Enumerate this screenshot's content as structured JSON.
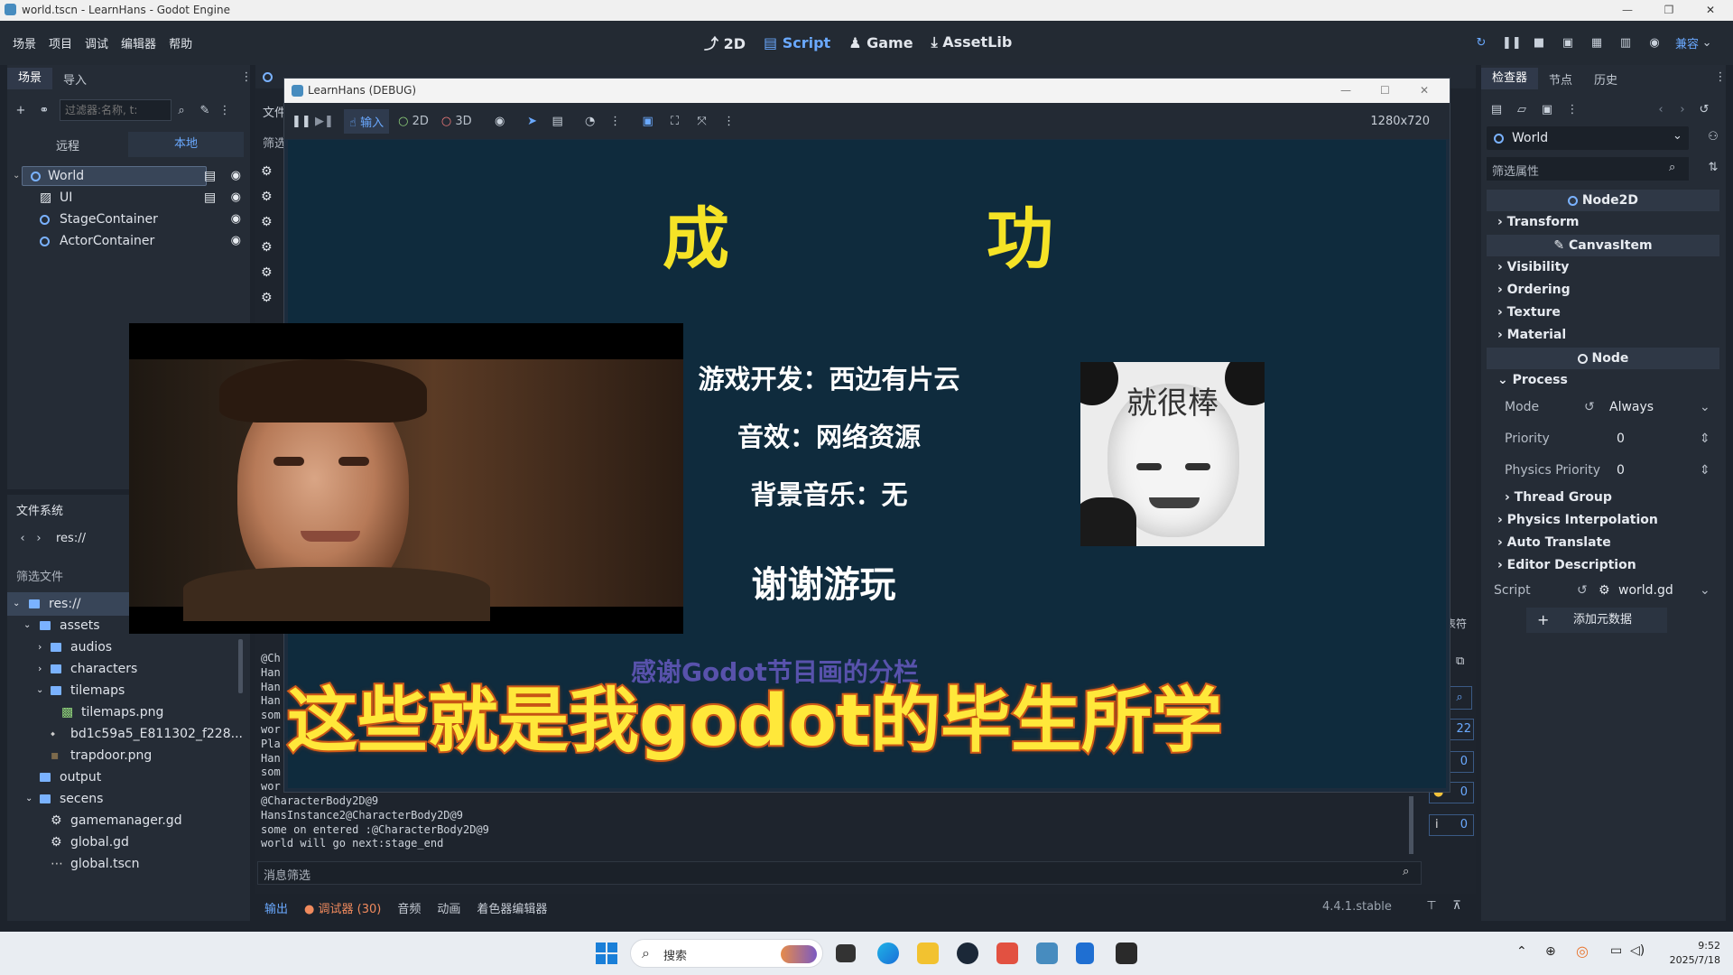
{
  "titlebar": {
    "title": "world.tscn - LearnHans - Godot Engine"
  },
  "menu": {
    "items": [
      "场景",
      "项目",
      "调试",
      "编辑器",
      "帮助"
    ]
  },
  "workspaces": {
    "w2d": "2D",
    "script": "Script",
    "game": "Game",
    "assetlib": "AssetLib"
  },
  "render_mode": "兼容",
  "scene_dock": {
    "tabs": [
      "场景",
      "导入"
    ],
    "filter_placeholder": "过滤器:名称, t:",
    "toggle": [
      "远程",
      "本地"
    ],
    "nodes": [
      "World",
      "UI",
      "StageContainer",
      "ActorContainer"
    ]
  },
  "filesystem": {
    "title": "文件系统",
    "path": "res://",
    "filter_placeholder": "筛选文件",
    "items": [
      "res://",
      "assets",
      "audios",
      "characters",
      "tilemaps",
      "tilemaps.png",
      "bd1c59a5_E811302_f228...",
      "trapdoor.png",
      "output",
      "secens",
      "gamemanager.gd",
      "global.gd",
      "global.tscn"
    ]
  },
  "game_window": {
    "title": "LearnHans (DEBUG)",
    "toolbar": {
      "input": "输入",
      "m2d": "2D",
      "m3d": "3D",
      "resolution": "1280x720"
    },
    "heading_left": "成",
    "heading_right": "功",
    "credits": [
      "游戏开发：西边有片云",
      "音效：网络资源",
      "背景音乐：无"
    ],
    "thanks": "谢谢游玩",
    "faded_text": "感谢Godot节目画的分栏",
    "meme_text": "就很棒",
    "overlay_caption": "这些就是我godot的毕生所学"
  },
  "console": {
    "partial_lines": [
      "@Ch",
      "Han",
      "Han",
      "Han",
      "som",
      "wor",
      "Pla",
      "Han",
      "som",
      "wor"
    ],
    "lines": [
      "@CharacterBody2D@9",
      "HansInstance2@CharacterBody2D@9",
      "some on entered :@CharacterBody2D@9",
      "world will go next:stage_end"
    ],
    "filter_placeholder": "消息筛选"
  },
  "bottom_tabs": {
    "output": "输出",
    "debugger": "调试器 (30)",
    "audio": "音频",
    "animation": "动画",
    "shader": "着色器编辑器"
  },
  "version": "4.4.1.stable",
  "right_counters": [
    "22",
    "0",
    "0",
    "0"
  ],
  "right_label": "表符",
  "inspector": {
    "tabs": [
      "检查器",
      "节点",
      "历史"
    ],
    "object": "World",
    "filter_placeholder": "筛选属性",
    "sections": {
      "node2d": "Node2D",
      "transform": "Transform",
      "canvasitem": "CanvasItem",
      "visibility": "Visibility",
      "ordering": "Ordering",
      "texture": "Texture",
      "material": "Material",
      "node": "Node",
      "process": "Process",
      "thread_group": "Thread Group",
      "physics_interp": "Physics Interpolation",
      "auto_translate": "Auto Translate",
      "editor_desc": "Editor Description"
    },
    "props": {
      "mode_label": "Mode",
      "mode_value": "Always",
      "priority_label": "Priority",
      "priority_value": "0",
      "physics_priority_label": "Physics Priority",
      "physics_priority_value": "0",
      "script_label": "Script",
      "script_value": "world.gd"
    },
    "add_metadata": "添加元数据"
  },
  "taskbar": {
    "search": "搜索",
    "time": "9:52",
    "date": "2025/7/18"
  },
  "colors": {
    "accent": "#6aa9ff",
    "heading_yellow": "#f5e326",
    "caption_yellow": "#ffe83a",
    "caption_outline": "#d9601c"
  }
}
